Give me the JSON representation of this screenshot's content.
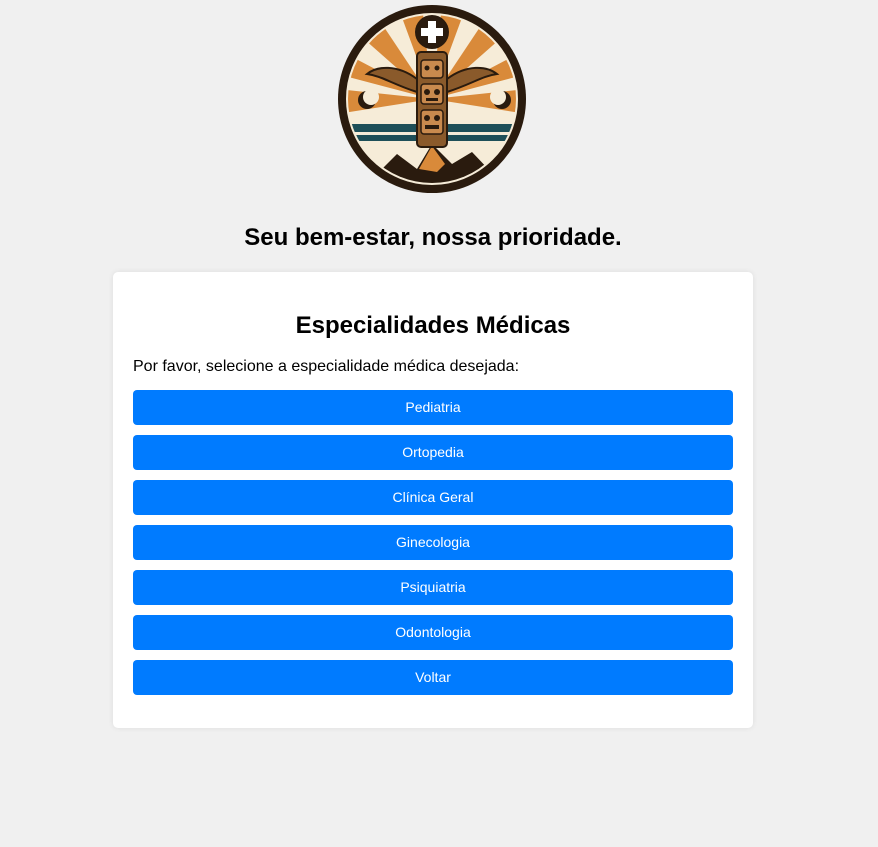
{
  "logo": {
    "icon": "totem-medical-logo",
    "colors": {
      "ring": "#2a1b0e",
      "orange": "#d98a3a",
      "cream": "#f6ecd8",
      "teal": "#1e4f58",
      "wood": "#8a5a2b"
    }
  },
  "tagline": "Seu bem-estar, nossa prioridade.",
  "card": {
    "title": "Especialidades Médicas",
    "intro": "Por favor, selecione a especialidade médica desejada:",
    "buttons": [
      {
        "label": "Pediatria"
      },
      {
        "label": "Ortopedia"
      },
      {
        "label": "Clínica Geral"
      },
      {
        "label": "Ginecologia"
      },
      {
        "label": "Psiquiatria"
      },
      {
        "label": "Odontologia"
      },
      {
        "label": "Voltar"
      }
    ]
  },
  "colors": {
    "page_background": "#f0f0f0",
    "card_background": "#ffffff",
    "button_background": "#007bff",
    "button_text": "#ffffff"
  }
}
